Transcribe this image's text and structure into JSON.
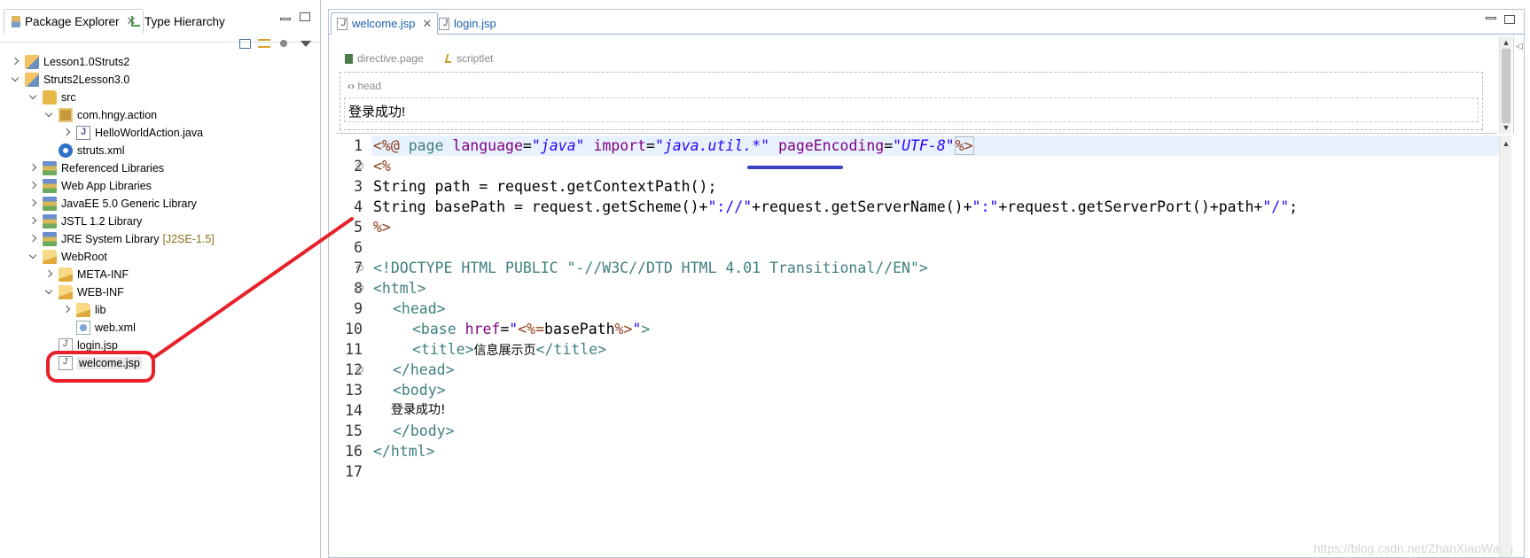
{
  "explorer": {
    "tabs": [
      {
        "label": "Package Explorer"
      },
      {
        "label": "Type Hierarchy"
      }
    ],
    "tree": [
      {
        "label": "Lesson1.0Struts2",
        "icon": "project-icon"
      },
      {
        "label": "Struts2Lesson3.0",
        "icon": "project-icon"
      },
      {
        "label": "src",
        "icon": "source-folder-icon"
      },
      {
        "label": "com.hngy.action",
        "icon": "package-icon"
      },
      {
        "label": "HelloWorldAction.java",
        "icon": "java-file-icon"
      },
      {
        "label": "struts.xml",
        "icon": "gear-icon"
      },
      {
        "label": "Referenced Libraries",
        "icon": "library-icon"
      },
      {
        "label": "Web App Libraries",
        "icon": "library-icon"
      },
      {
        "label": "JavaEE 5.0 Generic Library",
        "icon": "library-icon"
      },
      {
        "label": "JSTL 1.2 Library",
        "icon": "library-icon"
      },
      {
        "label": "JRE System Library",
        "suffix": "[J2SE-1.5]",
        "icon": "library-icon"
      },
      {
        "label": "WebRoot",
        "icon": "folder-open-icon"
      },
      {
        "label": "META-INF",
        "icon": "folder-icon"
      },
      {
        "label": "WEB-INF",
        "icon": "folder-open-icon"
      },
      {
        "label": "lib",
        "icon": "folder-icon"
      },
      {
        "label": "web.xml",
        "icon": "xml-file-icon"
      },
      {
        "label": "login.jsp",
        "icon": "jsp-file-icon"
      },
      {
        "label": "welcome.jsp",
        "icon": "jsp-file-icon"
      }
    ]
  },
  "editor": {
    "tabs": [
      {
        "label": "welcome.jsp"
      },
      {
        "label": "login.jsp"
      }
    ],
    "design": {
      "crumb_directive": "directive.page",
      "crumb_scriptlet": "scriptlet",
      "head_label": "head",
      "body_text": "登录成功!"
    },
    "line_numbers": [
      "1",
      "2",
      "3",
      "4",
      "5",
      "6",
      "7",
      "8",
      "9",
      "10",
      "11",
      "12",
      "13",
      "14",
      "15",
      "16",
      "17"
    ],
    "code": {
      "l1": {
        "open": "<%@",
        "page": " page ",
        "a1": "language",
        "eq1": "=",
        "v1": "\"java\"",
        "a2": " import",
        "eq2": "=",
        "v2": "\"java.util.*\"",
        "a3": " pageEncoding",
        "eq3": "=",
        "v3": "\"UTF-8\"",
        "close": "%>"
      },
      "l2": "<%",
      "l3": "String path = request.getContextPath();",
      "l4": {
        "a": "String basePath = request.getScheme()+",
        "s1": "\"://\"",
        "b": "+request.getServerName()+",
        "s2": "\":\"",
        "c": "+request.getServerPort()+path+",
        "s3": "\"/\"",
        "d": ";"
      },
      "l5": "%>",
      "l6": "",
      "l7": "<!DOCTYPE HTML PUBLIC \"-//W3C//DTD HTML 4.01 Transitional//EN\">",
      "l8": "<html>",
      "l9": "<head>",
      "l10": {
        "open": "<base",
        "attr": " href",
        "eq": "=",
        "q1": "\"",
        "s1": "<%=",
        "expr": "basePath",
        "s2": "%>",
        "q2": "\"",
        "close": ">"
      },
      "l11": {
        "open": "<title>",
        "text": "信息展示页",
        "close": "</title>"
      },
      "l12": "</head>",
      "l13": "<body>",
      "l14": "登录成功!",
      "l15": "</body>",
      "l16": "</html>",
      "l17": ""
    },
    "watermark": "https://blog.csdn.net/ZhanXiaoWang"
  },
  "colors": {
    "directive": "#8e3b1b",
    "tag": "#3f7f7f",
    "attribute": "#7f007f",
    "string": "#2a00ff",
    "annotation_red": "#e8202a",
    "annotation_blue": "#3a3fc4"
  }
}
